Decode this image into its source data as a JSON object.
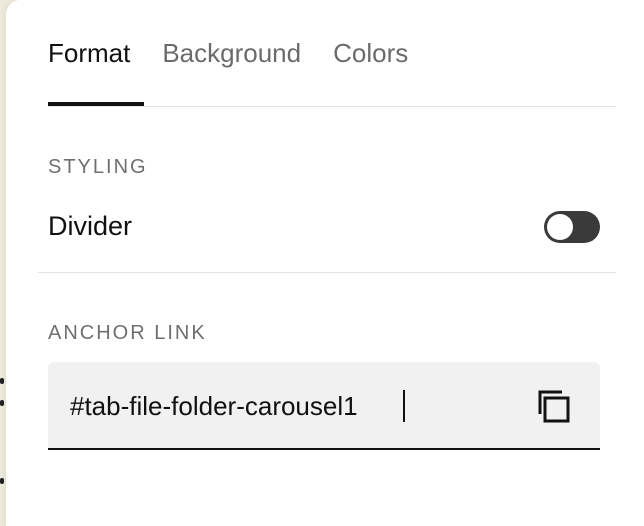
{
  "tabs": [
    {
      "label": "Format",
      "active": true
    },
    {
      "label": "Background",
      "active": false
    },
    {
      "label": "Colors",
      "active": false
    }
  ],
  "styling": {
    "heading": "STYLING",
    "divider_label": "Divider",
    "divider_enabled": false
  },
  "anchor_link": {
    "heading": "ANCHOR LINK",
    "value": "#tab-file-folder-carousel1",
    "copy_icon": "copy-icon"
  },
  "colors": {
    "panel": "#ffffff",
    "backdrop": "#efebdc",
    "active_text": "#111111",
    "inactive_text": "#6b6b6b",
    "toggle_track": "#3a3a3a",
    "field_background": "#f1f1f1"
  }
}
